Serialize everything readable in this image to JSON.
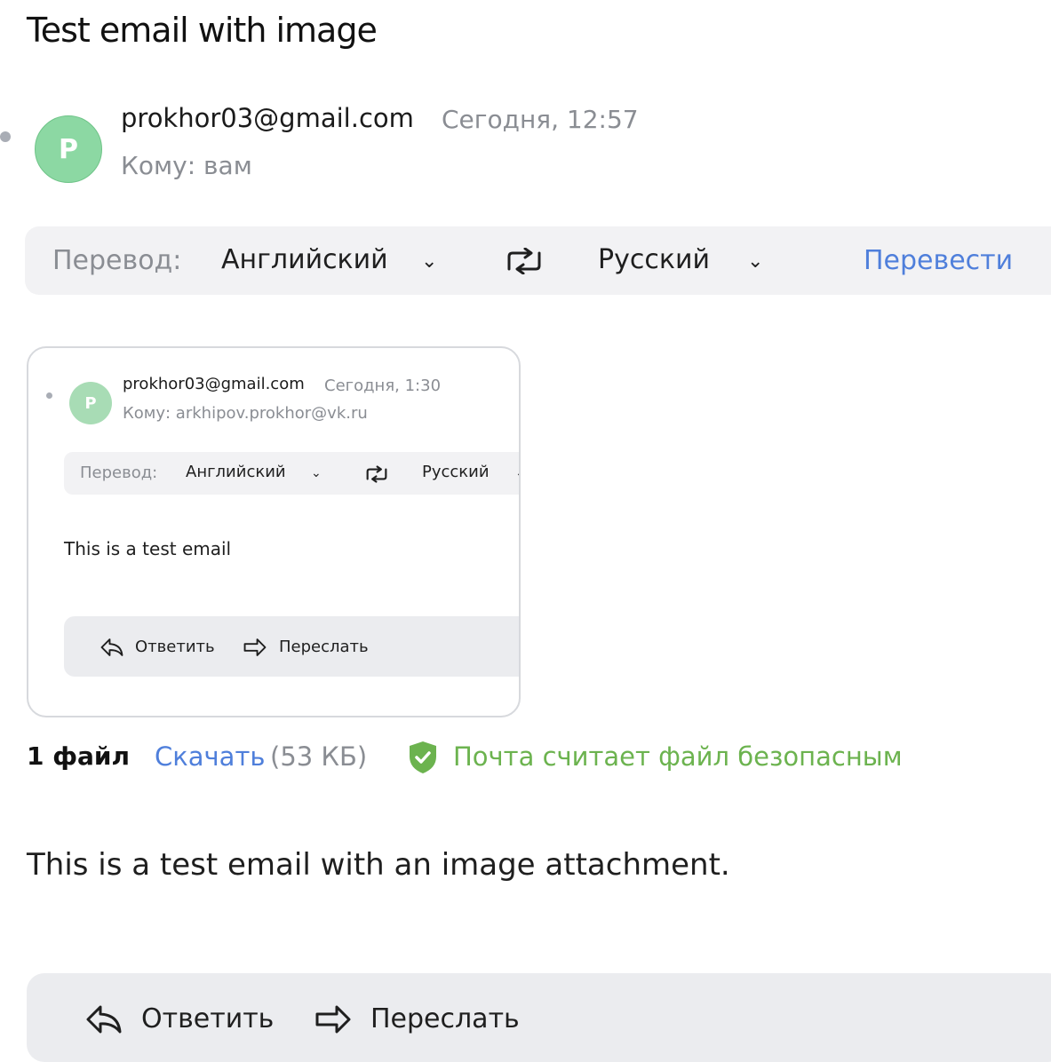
{
  "message": {
    "subject": "Test email with image",
    "sender_initial": "P",
    "sender": "prokhor03@gmail.com",
    "date": "Сегодня, 12:57",
    "recipient": "Кому: вам",
    "body": "This is a test email with an image attachment."
  },
  "translate": {
    "label": "Перевод:",
    "from_lang": "Английский",
    "to_lang": "Русский",
    "button": "Перевести",
    "chevron": "⌄"
  },
  "attachment_preview": {
    "sender_initial": "P",
    "sender": "prokhor03@gmail.com",
    "date": "Сегодня, 1:30",
    "recipient": "Кому: arkhipov.prokhor@vk.ru",
    "translate_label": "Перевод:",
    "from_lang": "Английский",
    "to_lang": "Русский",
    "body": "This is a test email",
    "reply": "Ответить",
    "forward": "Переслать"
  },
  "attachments": {
    "count_label": "1 файл",
    "download_label": "Скачать",
    "size": "(53 КБ)",
    "safety": "Почта считает файл безопасным",
    "safety_color": "#6cb34f"
  },
  "actions": {
    "reply": "Ответить",
    "forward": "Переслать"
  },
  "colors": {
    "link": "#4f7fdb",
    "avatar": "#8cd8a3",
    "muted": "#8a8d93"
  }
}
